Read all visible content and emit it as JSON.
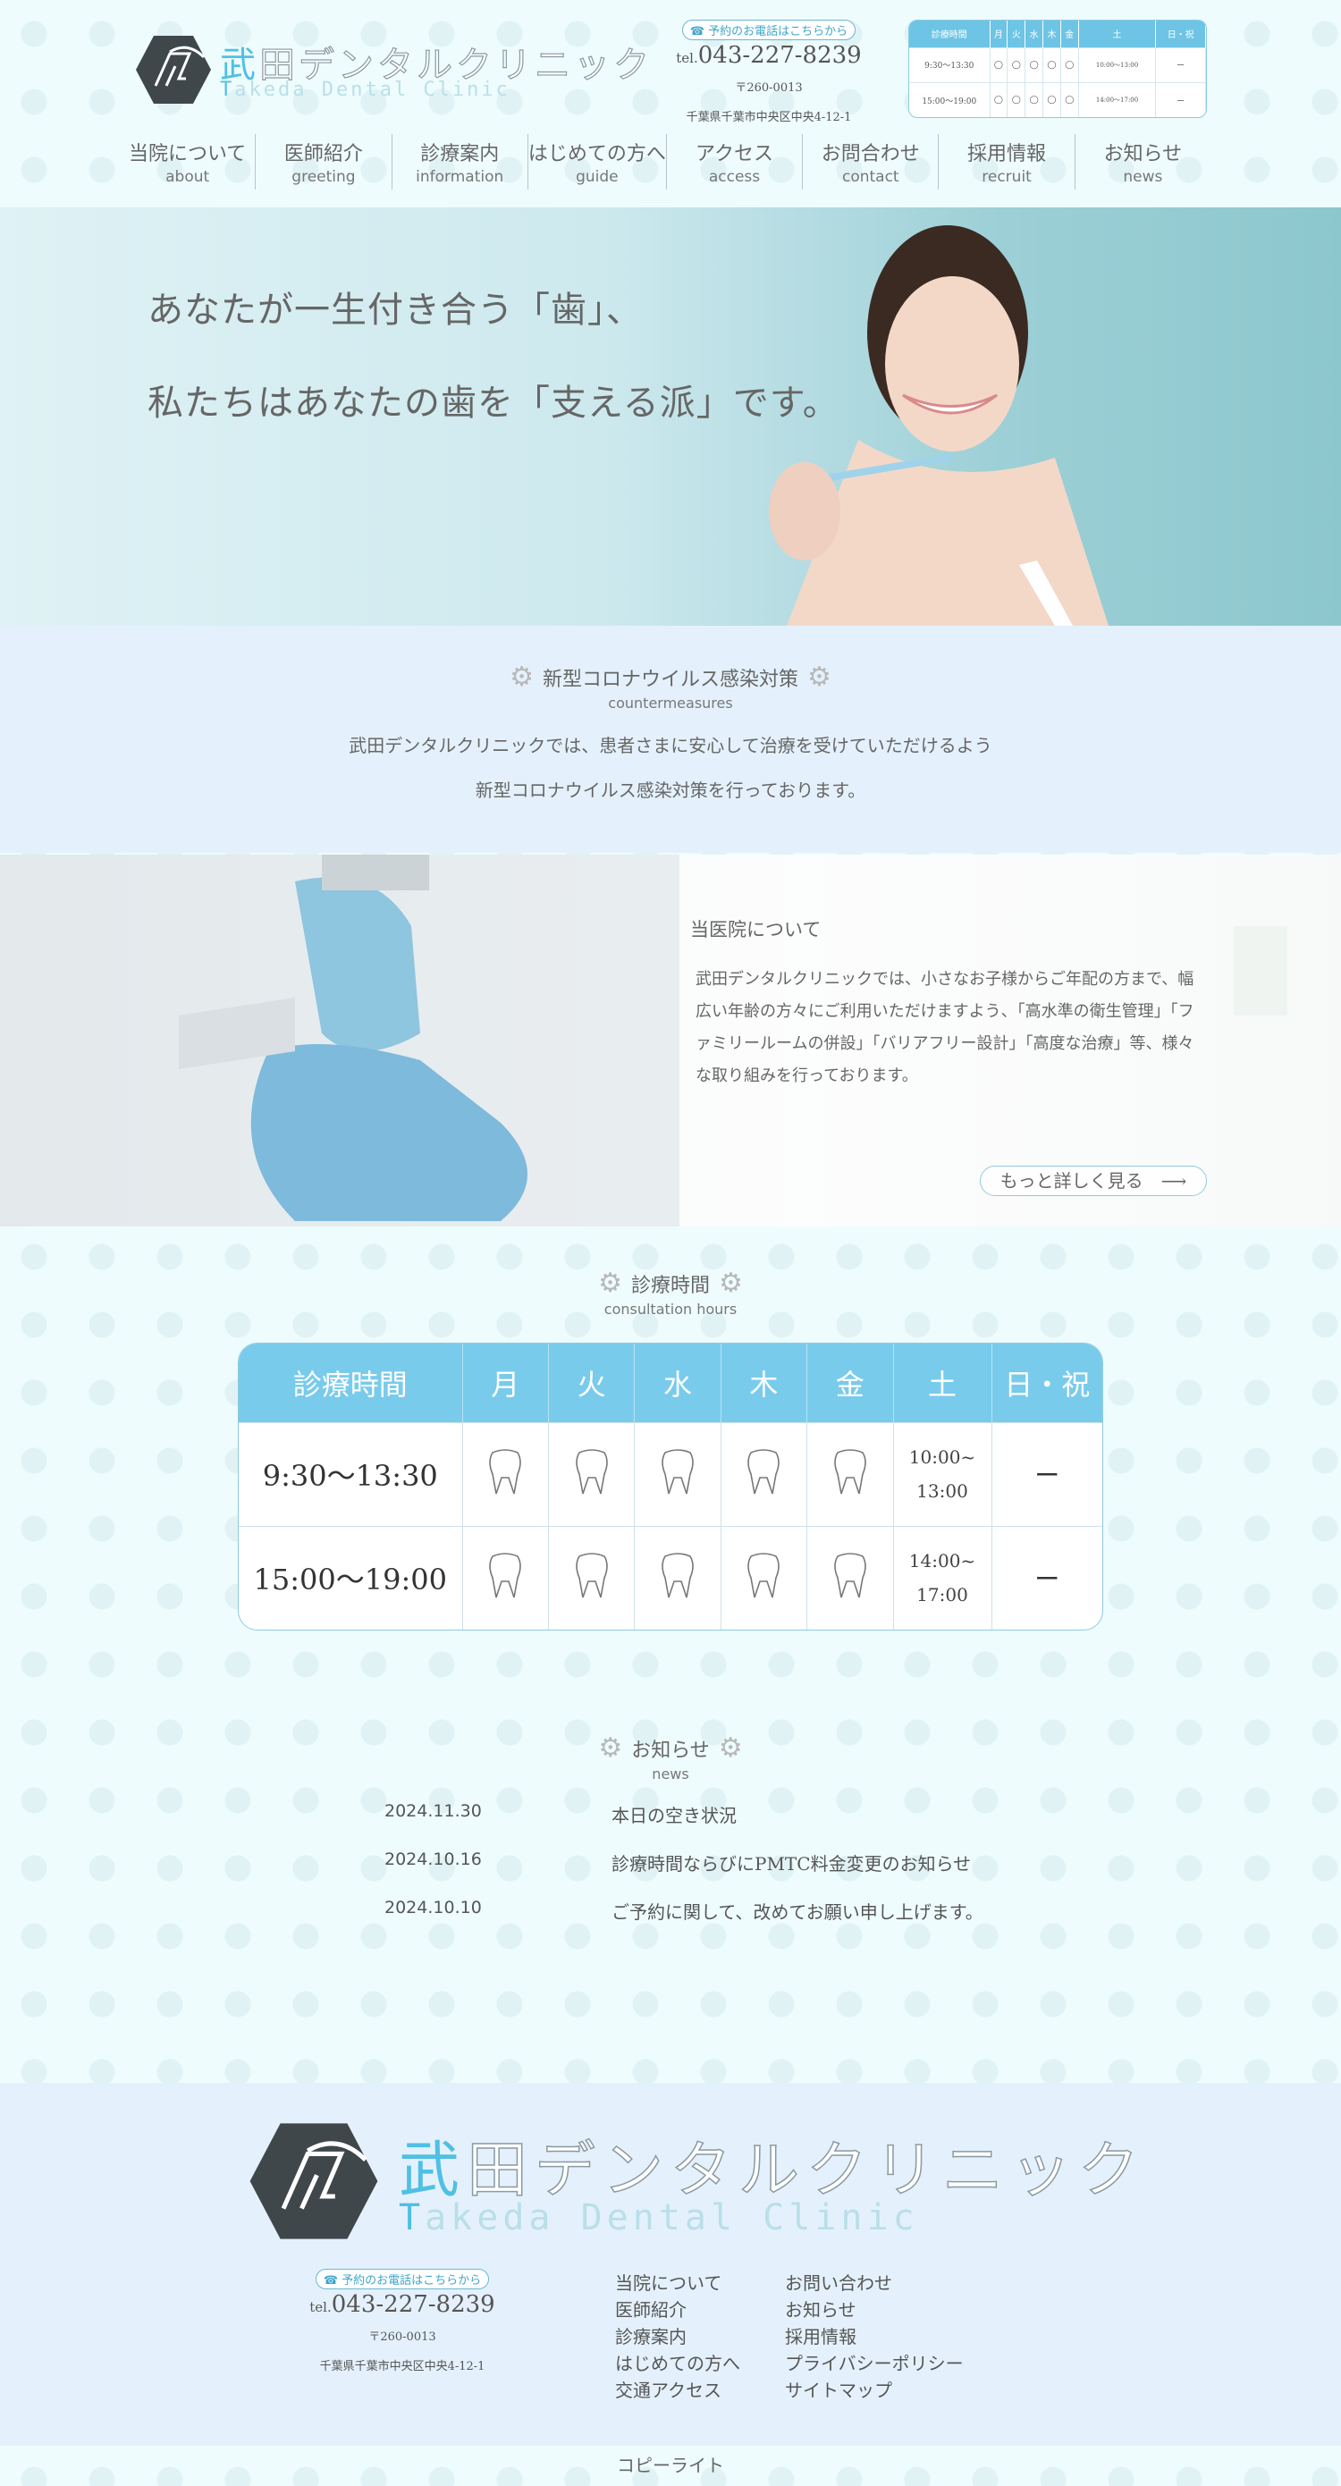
{
  "logo": {
    "jp_first": "武",
    "jp_rest": "田デンタルクリニック",
    "en_first": "T",
    "en_rest": "akeda Dental Clinic",
    "icon": "tooth-hexagon-logo-icon"
  },
  "contact": {
    "reservation_label": "予約のお電話はこちらから",
    "tel_prefix": "tel.",
    "tel": "043-227-8239",
    "zip": "〒260-0013",
    "address": "千葉県千葉市中央区中央4-12-1"
  },
  "mini_hours": {
    "headers": [
      "診療時間",
      "月",
      "火",
      "水",
      "木",
      "金",
      "土",
      "日・祝"
    ],
    "rows": [
      {
        "time": "9:30〜13:30",
        "sat": "10:00〜13:00",
        "holiday": "ー"
      },
      {
        "time": "15:00〜19:00",
        "sat": "14:00〜17:00",
        "holiday": "ー"
      }
    ]
  },
  "nav": [
    {
      "jp": "当院について",
      "en": "about"
    },
    {
      "jp": "医師紹介",
      "en": "greeting"
    },
    {
      "jp": "診療案内",
      "en": "information"
    },
    {
      "jp": "はじめての方へ",
      "en": "guide"
    },
    {
      "jp": "アクセス",
      "en": "access"
    },
    {
      "jp": "お問合わせ",
      "en": "contact"
    },
    {
      "jp": "採用情報",
      "en": "recruit"
    },
    {
      "jp": "お知らせ",
      "en": "news"
    }
  ],
  "hero": {
    "line1": "あなたが一生付き合う「歯」、",
    "line2": "私たちはあなたの歯を「支える派」です。"
  },
  "covid": {
    "title": "新型コロナウイルス感染対策",
    "subtitle": "countermeasures",
    "text1": "武田デンタルクリニックでは、患者さまに安心して治療を受けていただけるよう",
    "text2": "新型コロナウイルス感染対策を行っております。"
  },
  "about": {
    "title": "当医院について",
    "text": "武田デンタルクリニックでは、小さなお子様からご年配の方まで、幅広い年齢の方々にご利用いただけますよう、「高水準の衛生管理」「ファミリールームの併設」「バリアフリー設計」「高度な治療」等、様々な取り組みを行っております。",
    "more_label": "もっと詳しく見る　⟶"
  },
  "hours": {
    "title": "診療時間",
    "subtitle": "consultation hours",
    "headers": [
      "診療時間",
      "月",
      "火",
      "水",
      "木",
      "金",
      "土",
      "日・祝"
    ],
    "rows": [
      {
        "time": "9:30〜13:30",
        "sat_start": "10:00~",
        "sat_end": "13:00",
        "holiday": "ー"
      },
      {
        "time": "15:00〜19:00",
        "sat_start": "14:00~",
        "sat_end": "17:00",
        "holiday": "ー"
      }
    ]
  },
  "news": {
    "title": "お知らせ",
    "subtitle": "news",
    "items": [
      {
        "date": "2024.11.30",
        "title": "本日の空き状況"
      },
      {
        "date": "2024.10.16",
        "title": "診療時間ならびにPMTC料金変更のお知らせ"
      },
      {
        "date": "2024.10.10",
        "title": "ご予約に関して、改めてお願い申し上げます。"
      }
    ]
  },
  "footer": {
    "links_col1": [
      "当院について",
      "医師紹介",
      "診療案内",
      "はじめての方へ",
      "交通アクセス"
    ],
    "links_col2": [
      "お問い合わせ",
      "お知らせ",
      "採用情報",
      "プライバシーポリシー",
      "サイトマップ"
    ],
    "copyright": "コピーライト"
  },
  "colors": {
    "accent": "#4fc0e4",
    "table_header": "#79cbec",
    "section_bg": "#e4f1fc",
    "page_bg": "#eefcfd"
  }
}
